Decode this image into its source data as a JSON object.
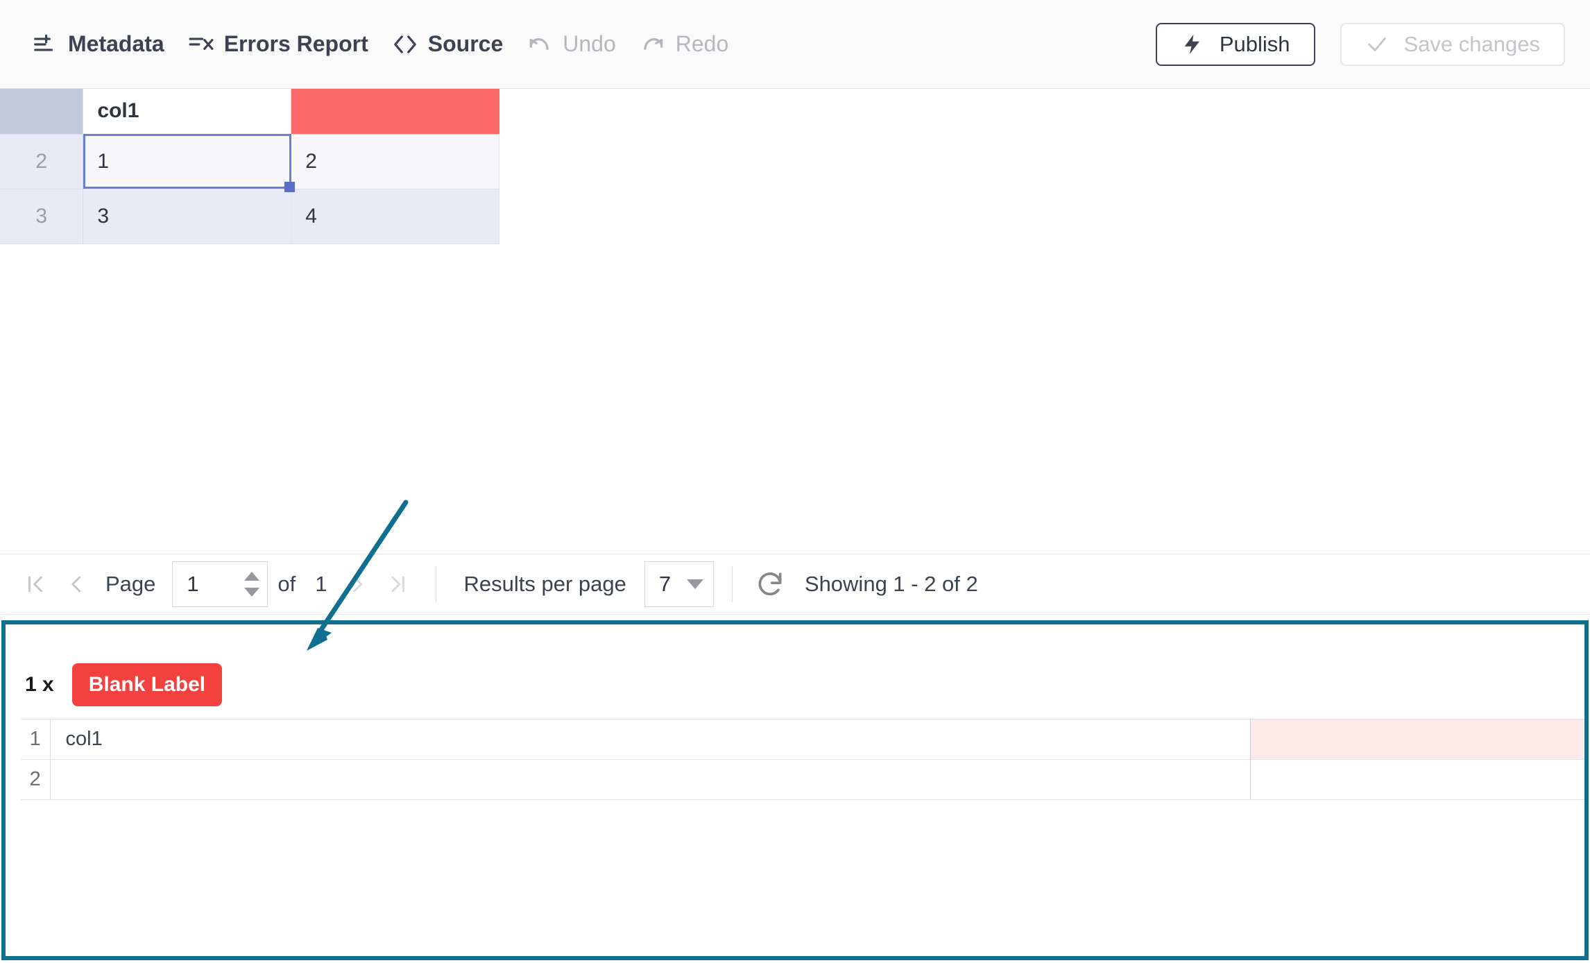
{
  "toolbar": {
    "items": [
      {
        "label": "Metadata",
        "icon": "sliders-icon",
        "state": "active"
      },
      {
        "label": "Errors Report",
        "icon": "errors-report-icon",
        "state": "active"
      },
      {
        "label": "Source",
        "icon": "code-brackets-icon",
        "state": "active"
      },
      {
        "label": "Undo",
        "icon": "undo-arrow-icon",
        "state": "disabled"
      },
      {
        "label": "Redo",
        "icon": "redo-arrow-icon",
        "state": "disabled"
      }
    ],
    "publish_label": "Publish",
    "publish_icon": "lightning-bolt-icon",
    "save_label": "Save changes",
    "save_icon": "checkmark-icon"
  },
  "grid": {
    "header": {
      "corner": "",
      "columns": [
        "col1",
        ""
      ]
    },
    "rows": [
      {
        "num": "2",
        "cells": [
          "1",
          "2"
        ]
      },
      {
        "num": "3",
        "cells": [
          "3",
          "4"
        ]
      }
    ],
    "selected_cell": "1",
    "error_column_color": "#fb6a67",
    "selection_color": "#6b7fd1"
  },
  "pagination": {
    "first_icon": "first-page-icon",
    "prev_icon": "previous-page-icon",
    "next_icon": "next-page-icon",
    "last_icon": "last-page-icon",
    "page_label": "Page",
    "page_value": "1",
    "of_label": "of",
    "total_pages": "1",
    "results_per_page_label": "Results per page",
    "results_per_page_value": "7",
    "refresh_icon": "refresh-icon",
    "showing_label": "Showing 1 - 2 of 2"
  },
  "errors_panel": {
    "count_label": "1 x",
    "badge_label": "Blank Label",
    "badge_color": "#f2413f",
    "border_color": "#0e6f90",
    "table": {
      "rows": [
        {
          "num": "1",
          "value": "col1",
          "error_value": ""
        },
        {
          "num": "2",
          "value": "",
          "error_value": ""
        }
      ]
    }
  },
  "annotation": {
    "type": "arrow",
    "color": "#0e6f90",
    "points_to": "errors-panel"
  }
}
